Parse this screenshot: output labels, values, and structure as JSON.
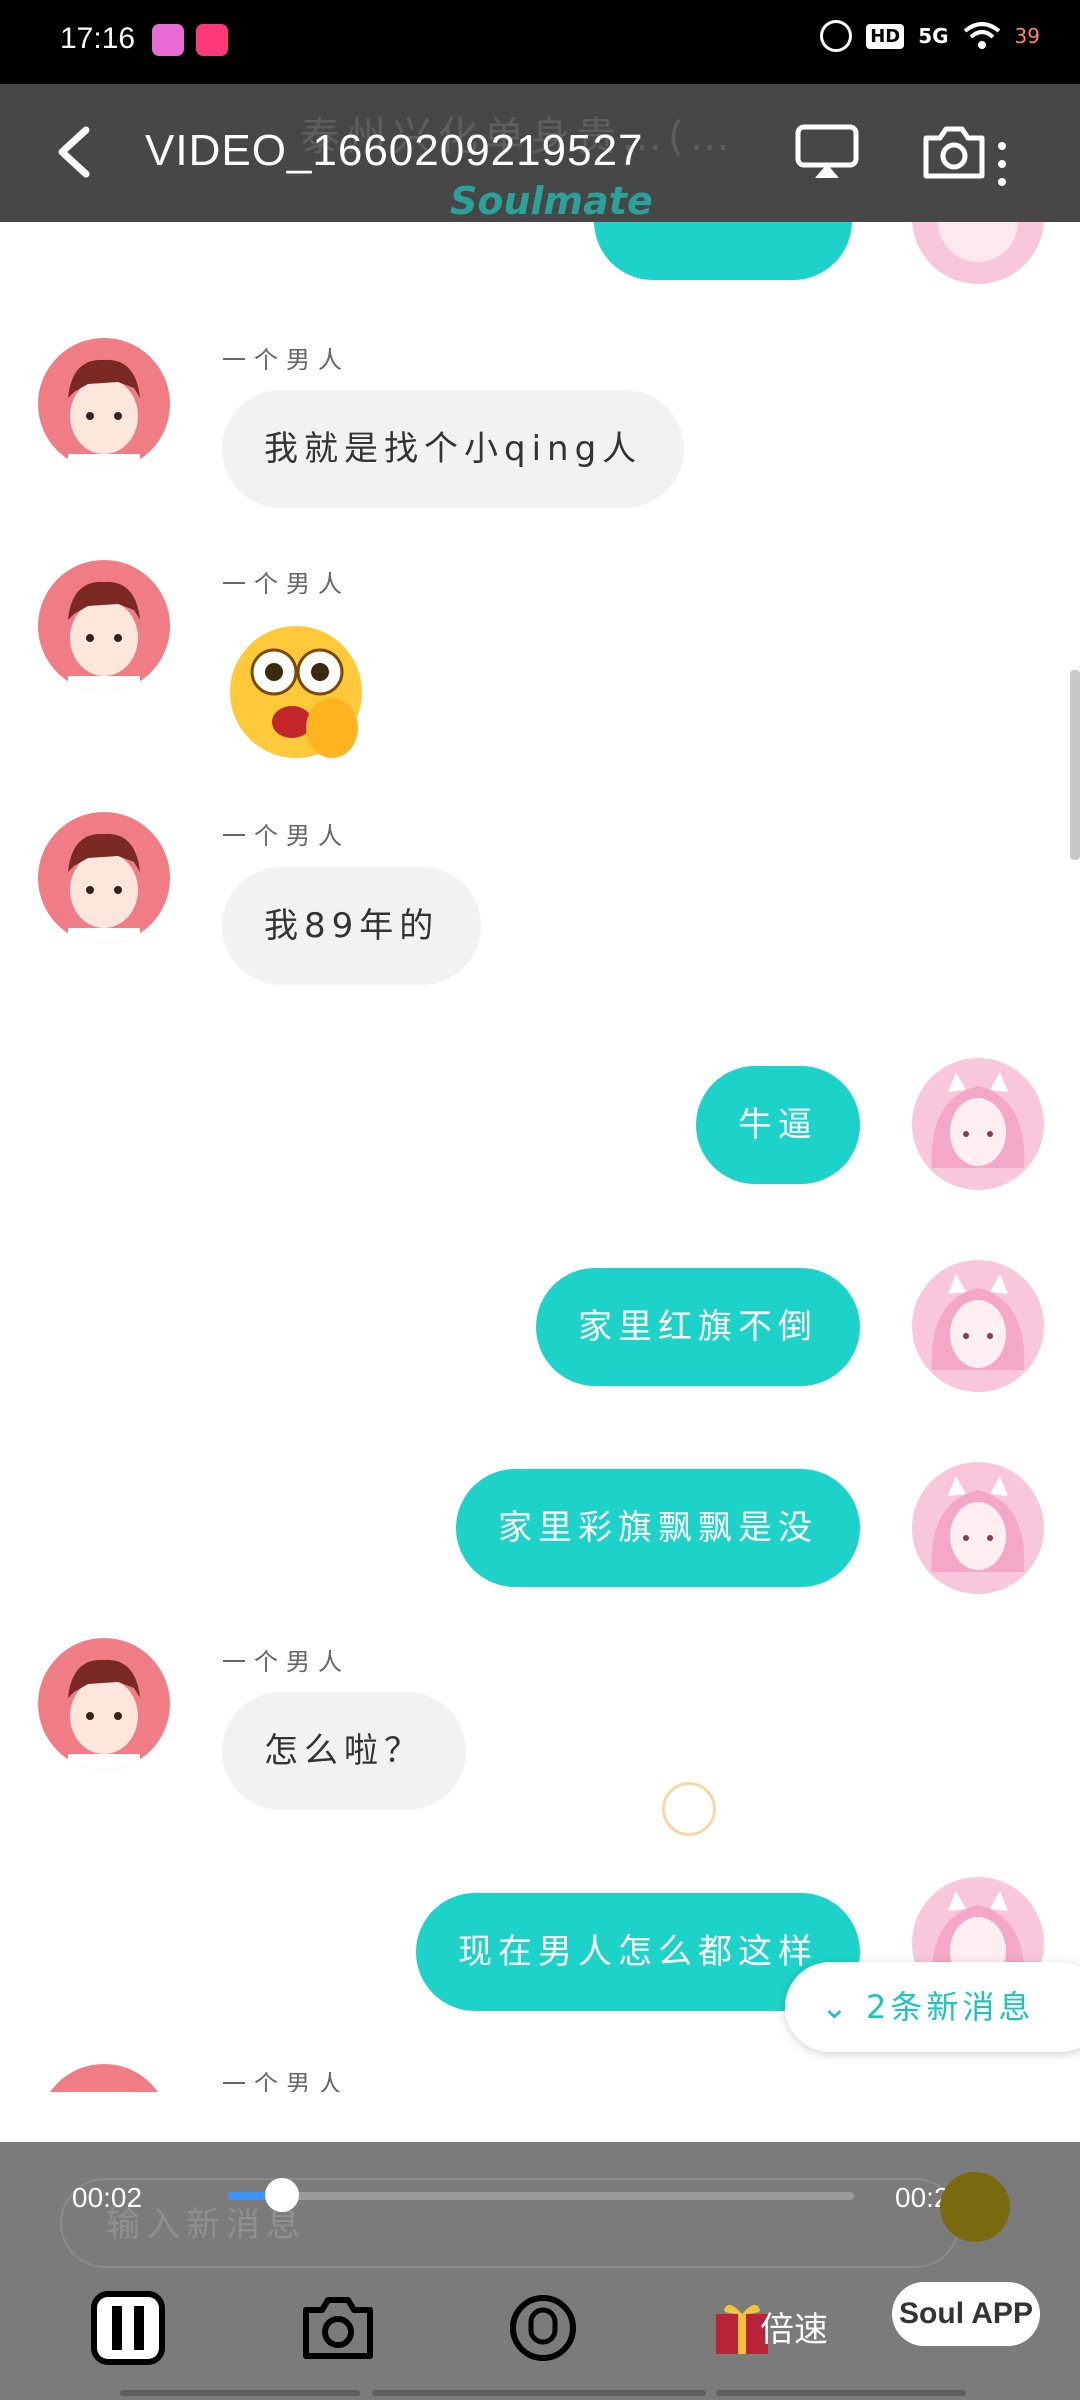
{
  "status_bar": {
    "time": "17:16",
    "network": "5G",
    "hd": "HD",
    "battery": "39"
  },
  "player": {
    "title": "VIDEO_1660209219527",
    "background_title": "泰州兴化单身贵…(…",
    "background_logo": "Soulmate",
    "current_time": "00:02",
    "total_time": "00:23",
    "progress": 0.087,
    "speed_label": "倍速",
    "watermark": "Soul APP"
  },
  "chat": {
    "messages": [
      {
        "sender": "一个男人",
        "text": "我就是找个小qing人",
        "direction": "in"
      },
      {
        "sender": "一个男人",
        "text": "",
        "emoji": "flushed-face",
        "direction": "in"
      },
      {
        "sender": "一个男人",
        "text": "我89年的",
        "direction": "in"
      },
      {
        "text": "牛逼",
        "direction": "out"
      },
      {
        "text": "家里红旗不倒",
        "direction": "out"
      },
      {
        "text": "家里彩旗飘飘是没",
        "direction": "out"
      },
      {
        "sender": "一个男人",
        "text": "怎么啦？",
        "direction": "in"
      },
      {
        "text": "现在男人怎么都这样",
        "direction": "out"
      },
      {
        "sender": "一个男人",
        "direction": "in"
      }
    ],
    "new_messages_label": "2条新消息",
    "input_placeholder": "输入新消息"
  },
  "colors": {
    "accent": "#1dd3c9",
    "incoming_bubble": "#f2f2f2",
    "progress": "#3b93ff",
    "overlay": "#474747"
  },
  "icons": [
    "back-icon",
    "cast-icon",
    "camera-icon",
    "more-icon",
    "pause-icon",
    "snapshot-icon",
    "gift-icon",
    "chevron-down-icon"
  ]
}
